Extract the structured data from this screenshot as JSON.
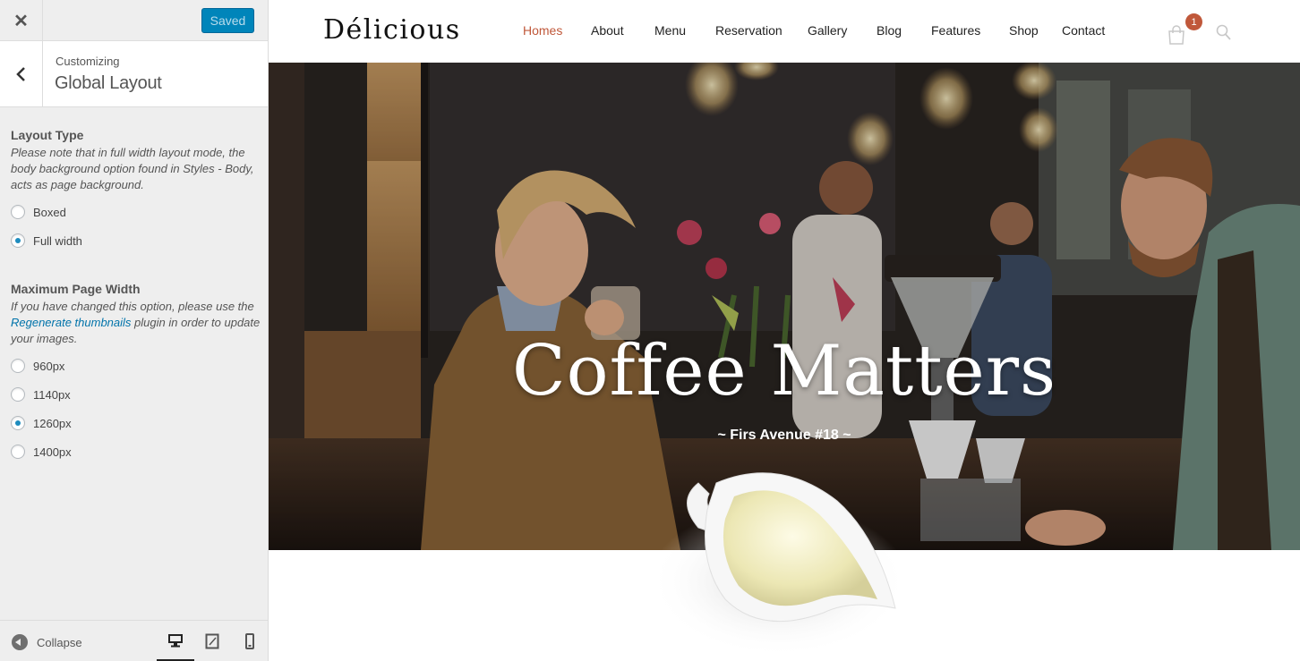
{
  "customizer": {
    "saved_label": "Saved",
    "section_small": "Customizing",
    "section_title": "Global Layout",
    "layout_type": {
      "title": "Layout Type",
      "description": "Please note that in full width layout mode, the body background option found in Styles - Body, acts as page background.",
      "options": [
        "Boxed",
        "Full width"
      ],
      "selected": "Full width"
    },
    "max_width": {
      "title": "Maximum Page Width",
      "desc_before": "If you have changed this option, please use the ",
      "desc_link": "Regenerate thumbnails",
      "desc_after": " plugin in order to update your images.",
      "options": [
        "960px",
        "1140px",
        "1260px",
        "1400px"
      ],
      "selected": "1260px"
    },
    "collapse_label": "Collapse",
    "active_device": "desktop"
  },
  "site": {
    "logo": "Délicious",
    "nav": [
      "Homes",
      "About",
      "Menu",
      "Reservation",
      "Gallery",
      "Blog",
      "Features",
      "Shop",
      "Contact"
    ],
    "active_nav": "Homes",
    "cart_count": "1",
    "hero_title": "Coffee Matters",
    "hero_subtitle": "~ Firs Avenue #18 ~"
  },
  "colors": {
    "accent": "#c0583a",
    "primary_button": "#0085ba",
    "radio_checked": "#1e8cbe",
    "link": "#0073aa"
  }
}
